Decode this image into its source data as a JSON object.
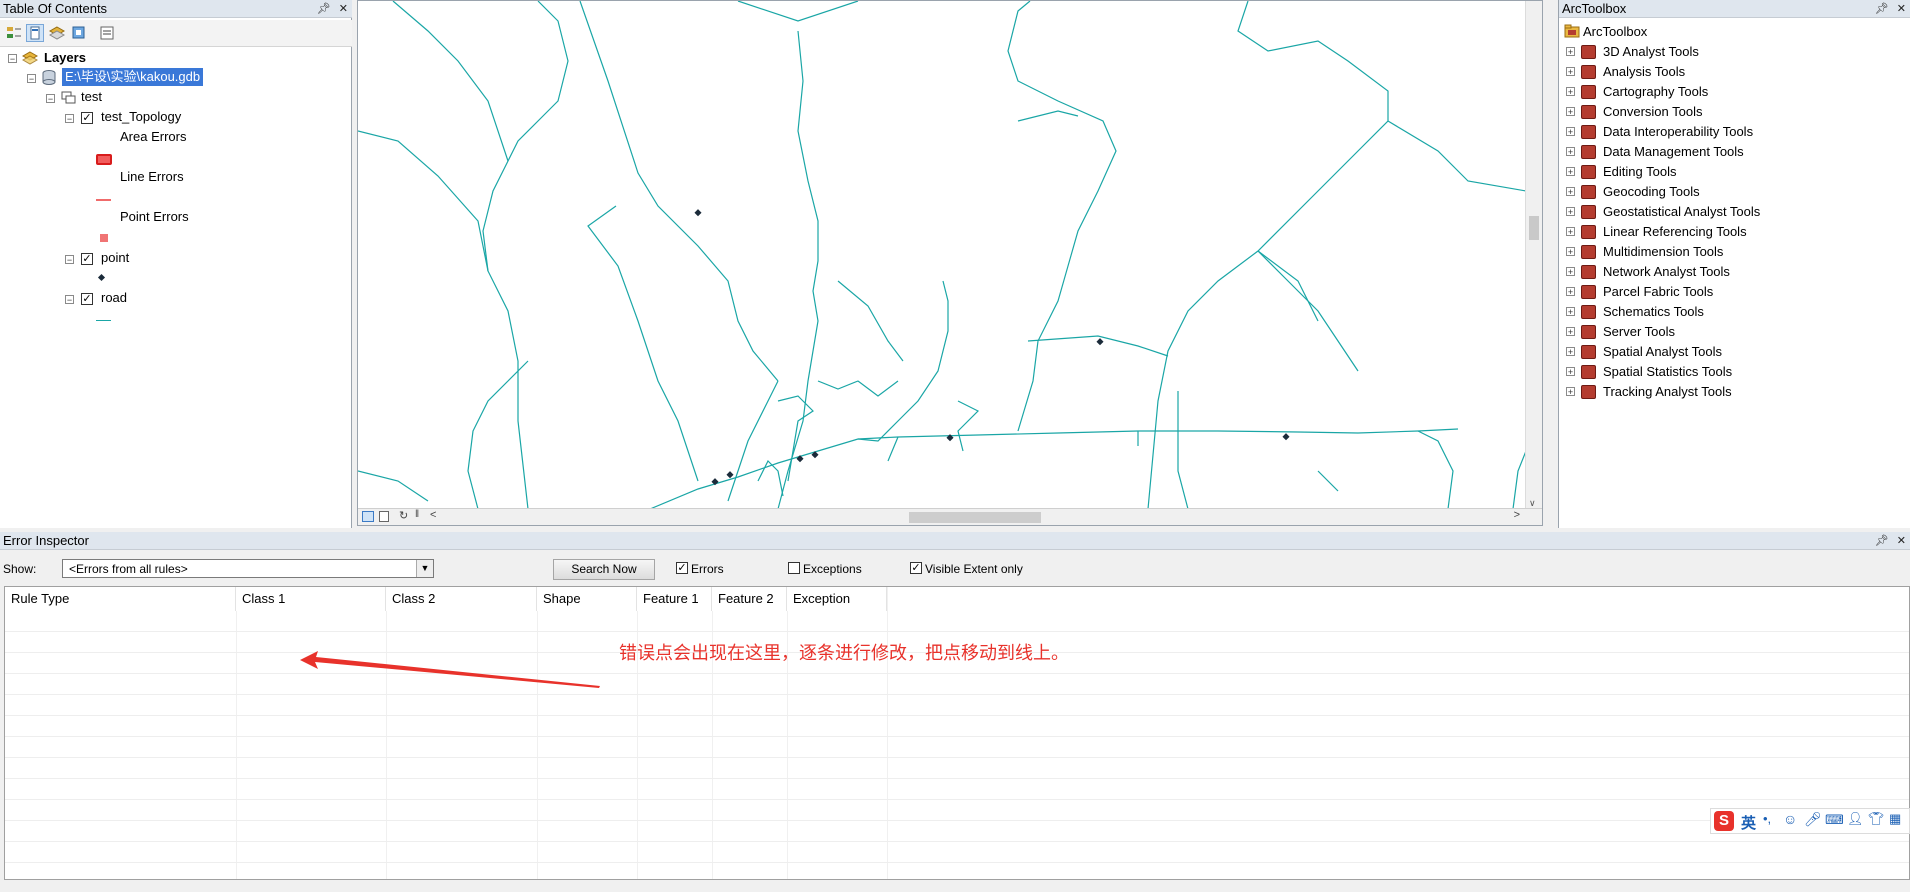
{
  "toc": {
    "title": "Table Of Contents",
    "layers_label": "Layers",
    "gdb_label": "E:\\毕设\\实验\\kakou.gdb",
    "dataset_label": "test",
    "topology_label": "test_Topology",
    "area_errors_label": "Area Errors",
    "line_errors_label": "Line Errors",
    "point_errors_label": "Point Errors",
    "point_layer_label": "point",
    "road_layer_label": "road"
  },
  "arctoolbox": {
    "title": "ArcToolbox",
    "root_label": "ArcToolbox",
    "items": [
      "3D Analyst Tools",
      "Analysis Tools",
      "Cartography Tools",
      "Conversion Tools",
      "Data Interoperability Tools",
      "Data Management Tools",
      "Editing Tools",
      "Geocoding Tools",
      "Geostatistical Analyst Tools",
      "Linear Referencing Tools",
      "Multidimension Tools",
      "Network Analyst Tools",
      "Parcel Fabric Tools",
      "Schematics Tools",
      "Server Tools",
      "Spatial Analyst Tools",
      "Spatial Statistics Tools",
      "Tracking Analyst Tools"
    ]
  },
  "error_inspector": {
    "title": "Error Inspector",
    "show_label": "Show:",
    "show_value": "<Errors from all rules>",
    "search_button": "Search Now",
    "errors_label": "Errors",
    "errors_checked": true,
    "exceptions_label": "Exceptions",
    "exceptions_checked": false,
    "visible_extent_label": "Visible Extent only",
    "visible_extent_checked": true,
    "columns": [
      "Rule Type",
      "Class 1",
      "Class 2",
      "Shape",
      "Feature 1",
      "Feature 2",
      "Exception"
    ]
  },
  "annotation": {
    "text": "错误点会出现在这里，逐条进行修改，把点移动到线上。",
    "color": "#e8322b"
  },
  "ime": {
    "lang_label": "英"
  },
  "colors": {
    "road": "#1aa6a6",
    "selection": "#3a78d8",
    "titlebar": "#dfe6ee",
    "error_red": "#e8322b"
  }
}
